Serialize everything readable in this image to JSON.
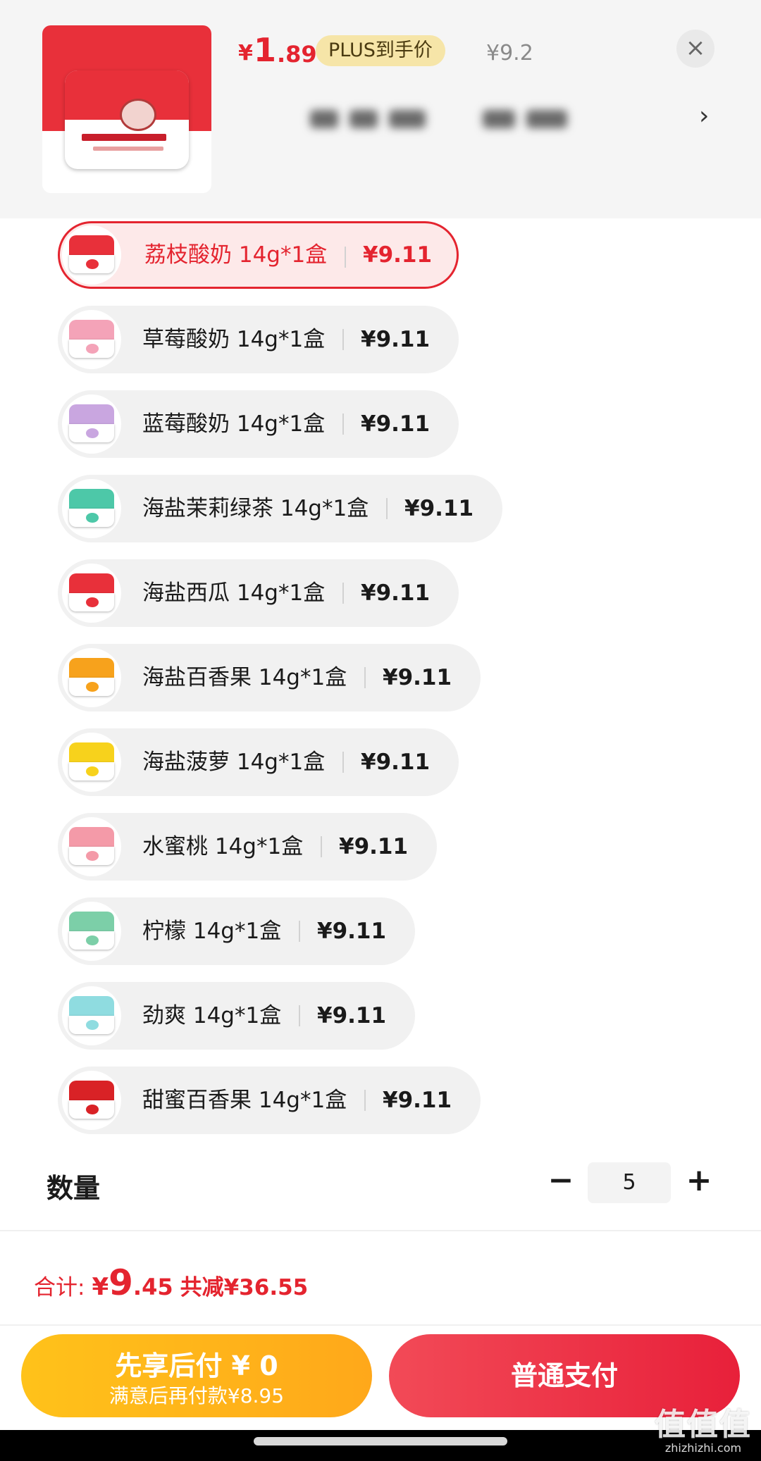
{
  "header": {
    "price_currency": "¥",
    "price_integer": "1",
    "price_decimal": ".89",
    "plus_badge": "PLUS到手价",
    "original_price": "¥9.2",
    "close_icon": "×",
    "chevron_icon": "›"
  },
  "options": [
    {
      "label": "荔枝酸奶 14g*1盒",
      "price": "¥9.11",
      "selected": true,
      "cap_color": "#e8303a"
    },
    {
      "label": "草莓酸奶 14g*1盒",
      "price": "¥9.11",
      "selected": false,
      "cap_color": "#f4a3b8"
    },
    {
      "label": "蓝莓酸奶 14g*1盒",
      "price": "¥9.11",
      "selected": false,
      "cap_color": "#c9a6e0"
    },
    {
      "label": "海盐茉莉绿茶 14g*1盒",
      "price": "¥9.11",
      "selected": false,
      "cap_color": "#4dc8a8"
    },
    {
      "label": "海盐西瓜 14g*1盒",
      "price": "¥9.11",
      "selected": false,
      "cap_color": "#e8303a"
    },
    {
      "label": "海盐百香果 14g*1盒",
      "price": "¥9.11",
      "selected": false,
      "cap_color": "#f7a21c"
    },
    {
      "label": "海盐菠萝 14g*1盒",
      "price": "¥9.11",
      "selected": false,
      "cap_color": "#f7d21c"
    },
    {
      "label": "水蜜桃 14g*1盒",
      "price": "¥9.11",
      "selected": false,
      "cap_color": "#f49aa8"
    },
    {
      "label": "柠檬 14g*1盒",
      "price": "¥9.11",
      "selected": false,
      "cap_color": "#7ccfa8"
    },
    {
      "label": "劲爽 14g*1盒",
      "price": "¥9.11",
      "selected": false,
      "cap_color": "#8fdce0"
    },
    {
      "label": "甜蜜百香果 14g*1盒",
      "price": "¥9.11",
      "selected": false,
      "cap_color": "#d92226"
    }
  ],
  "quantity": {
    "label": "数量",
    "minus": "−",
    "value": "5",
    "plus": "+"
  },
  "total": {
    "label": "合计:",
    "currency": "¥",
    "integer": "9",
    "decimal": ".45",
    "savings": "共减¥36.55"
  },
  "buttons": {
    "pay_later_title": "先享后付 ¥ 0",
    "pay_later_sub": "满意后再付款¥8.95",
    "pay_now": "普通支付"
  },
  "watermark": {
    "mark": "值值值",
    "site": "zhizhizhi.com"
  },
  "colors": {
    "accent": "#e4242f",
    "pay_later": "#ffb21a"
  }
}
